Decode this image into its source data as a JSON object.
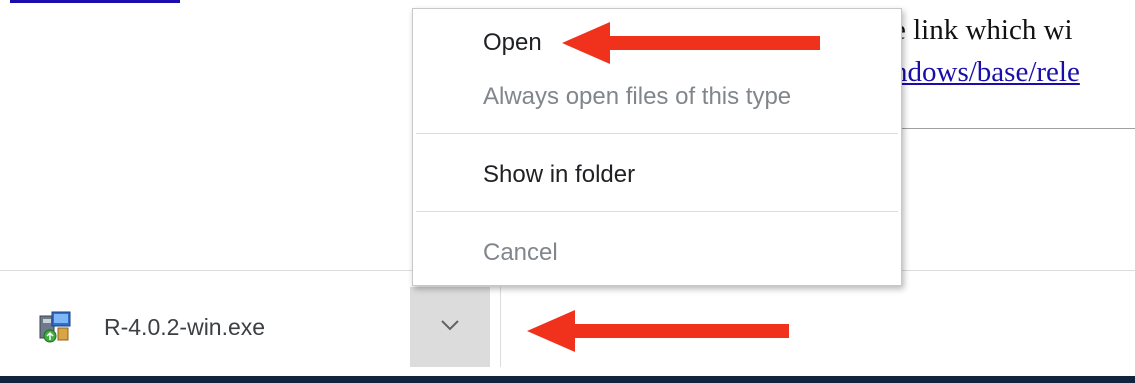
{
  "page": {
    "text_fragment": "e link which wi",
    "link_fragment": "ndows/base/rele"
  },
  "menu": {
    "items": [
      {
        "label": "Open",
        "enabled": true
      },
      {
        "label": "Always open files of this type",
        "enabled": false
      },
      {
        "label": "Show in folder",
        "enabled": true
      },
      {
        "label": "Cancel",
        "enabled": false
      }
    ]
  },
  "download": {
    "filename": "R-4.0.2-win.exe",
    "icon": "installer-icon",
    "menu_button_icon": "chevron-down-icon"
  },
  "annotations": {
    "arrow_color": "#f0311c"
  },
  "colors": {
    "link": "#1a0dab",
    "shelf_bottom": "#12233e",
    "button_bg": "#dcdcdc"
  }
}
